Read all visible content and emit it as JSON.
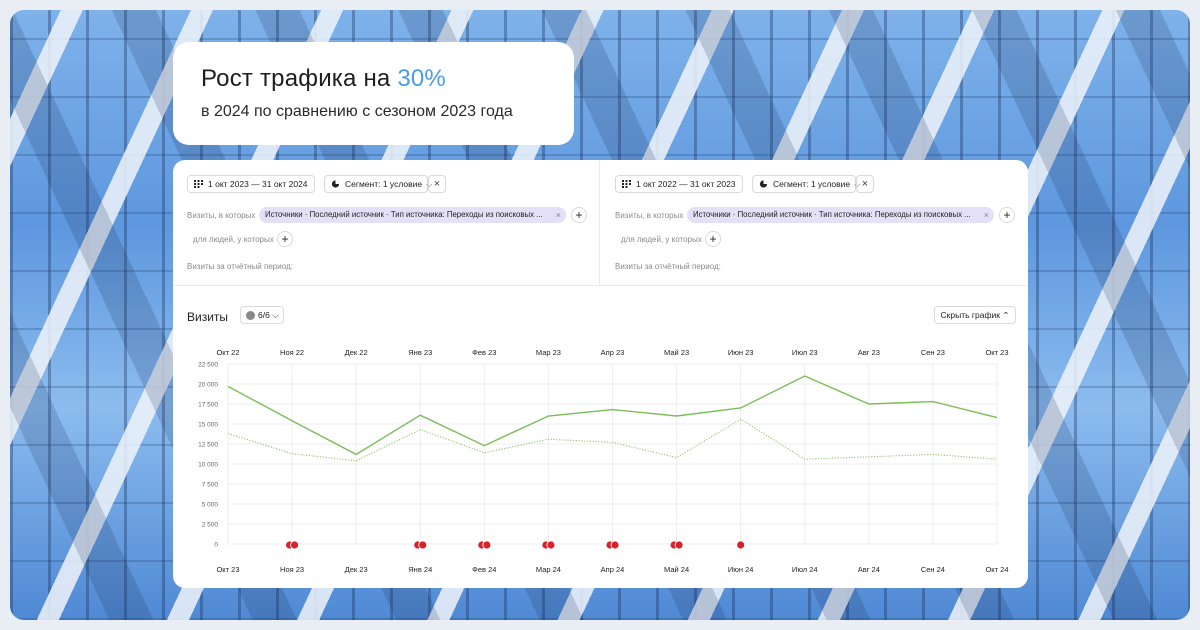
{
  "headline": {
    "prefix": "Рост трафика на ",
    "accent": "30%",
    "subtitle": "в 2024 по сравнению с сезоном 2023 года"
  },
  "colors": {
    "accent": "#4a9be8",
    "series_main": "#7dbd5a",
    "series_dotted": "#8ec86a",
    "marker": "#d4232b",
    "tag_bg": "#e4e0f7"
  },
  "panels": [
    {
      "date_range": "1 окт 2023 — 31 окт 2024",
      "segment": "Сегмент: 1 условие",
      "visits_label": "Визиты, в которых",
      "condition_tag": "Источники · Последний источник · Тип источника: Переходы из поисковых ...",
      "people_label": "для людей, у которых",
      "period_label": "Визиты за отчётный период:"
    },
    {
      "date_range": "1 окт 2022 — 31 окт 2023",
      "segment": "Сегмент: 1 условие",
      "visits_label": "Визиты, в которых",
      "condition_tag": "Источники · Последний источник · Тип источника: Переходы из поисковых ...",
      "people_label": "для людей, у которых",
      "period_label": "Визиты за отчётный период:"
    }
  ],
  "chart_header": {
    "title": "Визиты",
    "series_count": "6/6",
    "hide_button": "Скрыть график"
  },
  "chart_data": {
    "type": "line",
    "x_top": [
      "Окт 22",
      "Ноя 22",
      "Дек 22",
      "Янв 23",
      "Фев 23",
      "Мар 23",
      "Апр 23",
      "Май 23",
      "Июн 23",
      "Июл 23",
      "Авг 23",
      "Сен 23",
      "Окт 23"
    ],
    "x_bottom": [
      "Окт 23",
      "Ноя 23",
      "Дек 23",
      "Янв 24",
      "Фев 24",
      "Мар 24",
      "Апр 24",
      "Май 24",
      "Июн 24",
      "Июл 24",
      "Авг 24",
      "Сен 24",
      "Окт 24"
    ],
    "y_ticks": [
      0,
      2500,
      5000,
      7500,
      10000,
      12500,
      15000,
      17500,
      20000,
      22500
    ],
    "ylim": [
      0,
      22500
    ],
    "grid": true,
    "series": [
      {
        "style": "solid",
        "values": [
          19700,
          15400,
          11200,
          16100,
          12300,
          16000,
          16800,
          16000,
          17000,
          21000,
          17500,
          17800,
          15800
        ]
      },
      {
        "style": "dotted",
        "values": [
          13800,
          11300,
          10400,
          14300,
          11400,
          13100,
          12700,
          10800,
          15600,
          10600,
          10900,
          11200,
          10600
        ]
      }
    ],
    "annotation_markers": [
      {
        "x_index": 1,
        "count": 2
      },
      {
        "x_index": 3,
        "count": 2
      },
      {
        "x_index": 4,
        "count": 2
      },
      {
        "x_index": 5,
        "count": 2
      },
      {
        "x_index": 6,
        "count": 2
      },
      {
        "x_index": 7,
        "count": 2
      },
      {
        "x_index": 8,
        "count": 1
      }
    ]
  }
}
